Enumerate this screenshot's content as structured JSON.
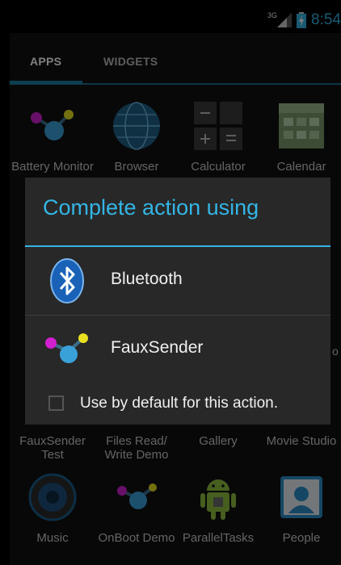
{
  "status_bar": {
    "network": "3G",
    "time": "8:54"
  },
  "tabs": [
    {
      "label": "APPS"
    },
    {
      "label": "WIDGETS"
    }
  ],
  "apps": [
    {
      "label": "Battery Monitor",
      "icon": "molecule-icon"
    },
    {
      "label": "Browser",
      "icon": "globe-icon"
    },
    {
      "label": "Calculator",
      "icon": "calculator-icon"
    },
    {
      "label": "Calendar",
      "icon": "calendar-icon"
    },
    {
      "label": "FauxSender Test",
      "icon": "molecule-icon"
    },
    {
      "label": "Files Read/ Write Demo",
      "icon": "molecule-icon"
    },
    {
      "label": "Gallery",
      "icon": "gallery-icon"
    },
    {
      "label": "Movie Studio",
      "icon": "movie-studio-icon"
    },
    {
      "label": "Music",
      "icon": "speaker-icon"
    },
    {
      "label": "OnBoot Demo",
      "icon": "molecule-icon"
    },
    {
      "label": "ParallelTasks",
      "icon": "android-icon"
    },
    {
      "label": "People",
      "icon": "contacts-icon"
    }
  ],
  "dialog": {
    "title": "Complete action using",
    "options": [
      {
        "label": "Bluetooth",
        "icon": "bluetooth-icon"
      },
      {
        "label": "FauxSender",
        "icon": "molecule-icon"
      }
    ],
    "checkbox": {
      "label": "Use by default for this action.",
      "checked": false
    }
  },
  "background_partial_text": "o",
  "colors": {
    "accent": "#33b5e5",
    "dialog_bg": "#282828",
    "tab_indicator": "#1b7fa6"
  }
}
